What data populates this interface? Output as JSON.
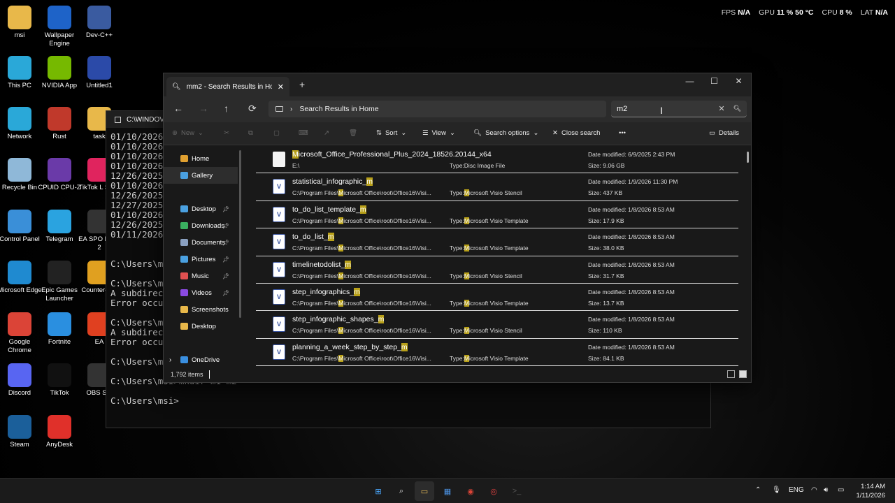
{
  "stats": {
    "fps_label": "FPS",
    "fps_value": "N/A",
    "gpu_label": "GPU",
    "gpu_value": "11 % 50 °C",
    "cpu_label": "CPU",
    "cpu_value": "8 %",
    "lat_label": "LAT",
    "lat_value": "N/A"
  },
  "desktop_icons": [
    {
      "label": "msi",
      "icon": "folder-icon",
      "color": "#e8b84a"
    },
    {
      "label": "Wallpaper Engine",
      "icon": "wallpaper-engine-icon",
      "color": "#1e63c8"
    },
    {
      "label": "Dev-C++",
      "icon": "devcpp-icon",
      "color": "#3a5ba0"
    },
    {
      "label": "This PC",
      "icon": "monitor-icon",
      "color": "#2aa8d8"
    },
    {
      "label": "NVIDIA App",
      "icon": "nvidia-icon",
      "color": "#76b900"
    },
    {
      "label": "Untitled1",
      "icon": "cpp-file-icon",
      "color": "#2b4aa8"
    },
    {
      "label": "Network",
      "icon": "network-icon",
      "color": "#2aa8d8"
    },
    {
      "label": "Rust",
      "icon": "rust-icon",
      "color": "#c0392b"
    },
    {
      "label": "task",
      "icon": "folder-icon",
      "color": "#e8b84a"
    },
    {
      "label": "Recycle Bin",
      "icon": "recycle-bin-icon",
      "color": "#8fb8d8"
    },
    {
      "label": "CPUID CPU-Z",
      "icon": "cpuz-icon",
      "color": "#6a3aa8"
    },
    {
      "label": "TikTok L Studi",
      "icon": "tiktok-live-icon",
      "color": "#e0245e"
    },
    {
      "label": "Control Panel",
      "icon": "control-panel-icon",
      "color": "#3a8fd8"
    },
    {
      "label": "Telegram",
      "icon": "telegram-icon",
      "color": "#2aa3e0"
    },
    {
      "label": "EA SPO FC™ 2",
      "icon": "ea-fc-icon",
      "color": "#333333"
    },
    {
      "label": "Microsoft Edge",
      "icon": "edge-icon",
      "color": "#1f8ad0"
    },
    {
      "label": "Epic Games Launcher",
      "icon": "epic-games-icon",
      "color": "#222222"
    },
    {
      "label": "Counter-S 2",
      "icon": "counter-strike-icon",
      "color": "#e0a020"
    },
    {
      "label": "Google Chrome",
      "icon": "chrome-icon",
      "color": "#db4437"
    },
    {
      "label": "Fortnite",
      "icon": "fortnite-icon",
      "color": "#2a8fe0"
    },
    {
      "label": "EA",
      "icon": "ea-icon",
      "color": "#e04020"
    },
    {
      "label": "Discord",
      "icon": "discord-icon",
      "color": "#5865f2"
    },
    {
      "label": "TikTok",
      "icon": "tiktok-icon",
      "color": "#111111"
    },
    {
      "label": "OBS Stu",
      "icon": "obs-icon",
      "color": "#333333"
    },
    {
      "label": "Steam",
      "icon": "steam-icon",
      "color": "#1b5f9a"
    },
    {
      "label": "AnyDesk",
      "icon": "anydesk-icon",
      "color": "#e0302a"
    }
  ],
  "terminal": {
    "title": "C:\\WINDOV",
    "lines": [
      "01/10/2026",
      "01/10/2026",
      "01/10/2026",
      "01/10/2026",
      "12/26/2025",
      "01/10/2026",
      "12/26/2025",
      "12/27/2025",
      "01/10/2026",
      "12/26/2025",
      "01/11/2026",
      "",
      "",
      "C:\\Users\\msi",
      "",
      "C:\\Users\\msi",
      "A subdirect",
      "Error occur",
      "",
      "C:\\Users\\msi",
      "A subdirect",
      "Error occur",
      "",
      "C:\\Users\\msi>",
      "",
      "C:\\Users\\msi>mkdir m1 m2",
      "",
      "C:\\Users\\msi>"
    ]
  },
  "explorer": {
    "tab_title": "mm2 - Search Results in Hom",
    "address": "Search Results in Home",
    "search_value": "m2",
    "toolbar": {
      "new": "New",
      "sort": "Sort",
      "view": "View",
      "search_options": "Search options",
      "close_search": "Close search",
      "details": "Details"
    },
    "sidebar": [
      {
        "label": "Home",
        "icon": "home-icon",
        "color": "#e0a030",
        "selected": false,
        "pinned": false
      },
      {
        "label": "Gallery",
        "icon": "gallery-icon",
        "color": "#4aa0e0",
        "selected": true,
        "pinned": false
      },
      {
        "label": "Desktop",
        "icon": "desktop-folder-icon",
        "color": "#4aa0e0",
        "selected": false,
        "pinned": true
      },
      {
        "label": "Downloads",
        "icon": "downloads-icon",
        "color": "#3ab060",
        "selected": false,
        "pinned": true
      },
      {
        "label": "Documents",
        "icon": "documents-icon",
        "color": "#8aa0c0",
        "selected": false,
        "pinned": true
      },
      {
        "label": "Pictures",
        "icon": "pictures-icon",
        "color": "#4aa0e0",
        "selected": false,
        "pinned": true
      },
      {
        "label": "Music",
        "icon": "music-icon",
        "color": "#e05050",
        "selected": false,
        "pinned": true
      },
      {
        "label": "Videos",
        "icon": "videos-icon",
        "color": "#8a4ae0",
        "selected": false,
        "pinned": true
      },
      {
        "label": "Screenshots",
        "icon": "folder-icon",
        "color": "#e8b84a",
        "selected": false,
        "pinned": false
      },
      {
        "label": "Desktop",
        "icon": "folder-icon",
        "color": "#e8b84a",
        "selected": false,
        "pinned": false
      },
      {
        "label": "OneDrive",
        "icon": "onedrive-icon",
        "color": "#3a8fe0",
        "selected": false,
        "pinned": false
      }
    ],
    "files": [
      {
        "pre": "",
        "hl": "M",
        "post": "icrosoft_Office_Professional_Plus_2024_18526.20144_x64",
        "path": "E:\\",
        "path_hl": "",
        "path_post": "",
        "type_label": "Type:",
        "type_hl": "",
        "type": "Disc Image File",
        "date": "Date modified: 6/9/2025 2:43 PM",
        "size": "Size: 9.06 GB",
        "icon": "disc-image-icon"
      },
      {
        "pre": "statistical_infographic_",
        "hl": "m",
        "post": "",
        "path": "C:\\Program Files\\",
        "path_hl": "M",
        "path_post": "icrosoft Office\\root\\Office16\\Visi...",
        "type_label": "Type:",
        "type_hl": "M",
        "type": "icrosoft Visio Stencil",
        "date": "Date modified: 1/9/2026 11:30 PM",
        "size": "Size: 437 KB",
        "icon": "visio-icon"
      },
      {
        "pre": "to_do_list_template_",
        "hl": "m",
        "post": "",
        "path": "C:\\Program Files\\",
        "path_hl": "M",
        "path_post": "icrosoft Office\\root\\Office16\\Visi...",
        "type_label": "Type:",
        "type_hl": "M",
        "type": "icrosoft Visio Template",
        "date": "Date modified: 1/8/2026 8:53 AM",
        "size": "Size: 17.9 KB",
        "icon": "visio-icon"
      },
      {
        "pre": "to_do_list_",
        "hl": "m",
        "post": "",
        "path": "C:\\Program Files\\",
        "path_hl": "M",
        "path_post": "icrosoft Office\\root\\Office16\\Visi...",
        "type_label": "Type:",
        "type_hl": "M",
        "type": "icrosoft Visio Template",
        "date": "Date modified: 1/8/2026 8:53 AM",
        "size": "Size: 38.0 KB",
        "icon": "visio-icon"
      },
      {
        "pre": "timelinetodolist_",
        "hl": "m",
        "post": "",
        "path": "C:\\Program Files\\",
        "path_hl": "M",
        "path_post": "icrosoft Office\\root\\Office16\\Visi...",
        "type_label": "Type:",
        "type_hl": "M",
        "type": "icrosoft Visio Stencil",
        "date": "Date modified: 1/8/2026 8:53 AM",
        "size": "Size: 31.7 KB",
        "icon": "visio-icon"
      },
      {
        "pre": "step_infographics_",
        "hl": "m",
        "post": "",
        "path": "C:\\Program Files\\",
        "path_hl": "M",
        "path_post": "icrosoft Office\\root\\Office16\\Visi...",
        "type_label": "Type:",
        "type_hl": "M",
        "type": "icrosoft Visio Template",
        "date": "Date modified: 1/8/2026 8:53 AM",
        "size": "Size: 13.7 KB",
        "icon": "visio-icon"
      },
      {
        "pre": "step_infographic_shapes_",
        "hl": "m",
        "post": "",
        "path": "C:\\Program Files\\",
        "path_hl": "M",
        "path_post": "icrosoft Office\\root\\Office16\\Visi...",
        "type_label": "Type:",
        "type_hl": "M",
        "type": "icrosoft Visio Stencil",
        "date": "Date modified: 1/8/2026 8:53 AM",
        "size": "Size: 110 KB",
        "icon": "visio-icon"
      },
      {
        "pre": "planning_a_week_step_by_step_",
        "hl": "m",
        "post": "",
        "path": "C:\\Program Files\\",
        "path_hl": "M",
        "path_post": "icrosoft Office\\root\\Office16\\Visi...",
        "type_label": "Type:",
        "type_hl": "M",
        "type": "icrosoft Visio Template",
        "date": "Date modified: 1/8/2026 8:53 AM",
        "size": "Size: 84.1 KB",
        "icon": "visio-icon"
      }
    ],
    "status": "1,792 items"
  },
  "taskbar": {
    "apps": [
      "windows-start-icon",
      "search-icon",
      "file-explorer-icon",
      "microsoft-store-icon",
      "chrome-icon",
      "obs-icon",
      "terminal-icon"
    ],
    "lang": "ENG",
    "time": "1:14 AM",
    "date": "1/11/2026"
  }
}
